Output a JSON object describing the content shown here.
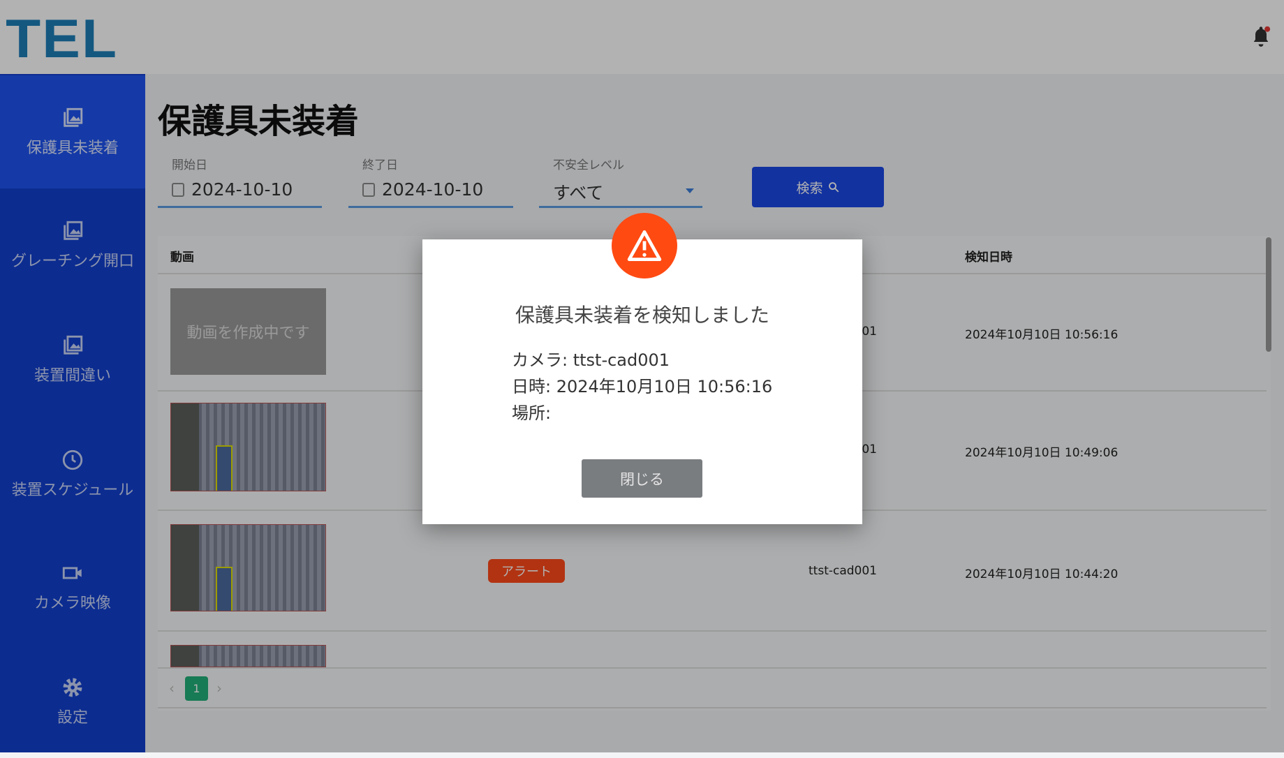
{
  "header": {
    "logo_text": "TEL",
    "notification_icon": "bell-icon"
  },
  "sidebar": {
    "items": [
      {
        "label": "保護具未装着",
        "icon": "photo-library-icon",
        "active": true
      },
      {
        "label": "グレーチング開口",
        "icon": "photo-library-icon"
      },
      {
        "label": "装置間違い",
        "icon": "photo-library-icon"
      },
      {
        "label": "装置スケジュール",
        "icon": "clock-icon"
      },
      {
        "label": "カメラ映像",
        "icon": "video-camera-icon"
      },
      {
        "label": "設定",
        "icon": "gear-icon"
      }
    ]
  },
  "page": {
    "title": "保護具未装着"
  },
  "filters": {
    "start_label": "開始日",
    "start_value": "2024-10-10",
    "end_label": "終了日",
    "end_value": "2024-10-10",
    "level_label": "不安全レベル",
    "level_value": "すべて",
    "search_label": "検索"
  },
  "table": {
    "headers": {
      "video": "動画",
      "detected_at": "検知日時"
    },
    "rows": [
      {
        "thumbnail": "動画を作成中です",
        "camera": "ttst-cad001",
        "detected_at": "2024年10月10日 10:56:16"
      },
      {
        "camera": "ttst-cad001",
        "detected_at": "2024年10月10日 10:49:06"
      },
      {
        "status": "アラート",
        "camera": "ttst-cad001",
        "detected_at": "2024年10月10日 10:44:20"
      }
    ]
  },
  "pagination": {
    "current": "1"
  },
  "modal": {
    "title": "保護具未装着を検知しました",
    "camera": "カメラ: ttst-cad001",
    "datetime": "日時: 2024年10月10日 10:56:16",
    "location": "場所:",
    "close_label": "閉じる"
  },
  "colors": {
    "sidebar": "#123fcf",
    "active": "#1f54f0",
    "alert": "#ff4a1a",
    "button": "#1a48e6",
    "page_active": "#22b07a"
  }
}
